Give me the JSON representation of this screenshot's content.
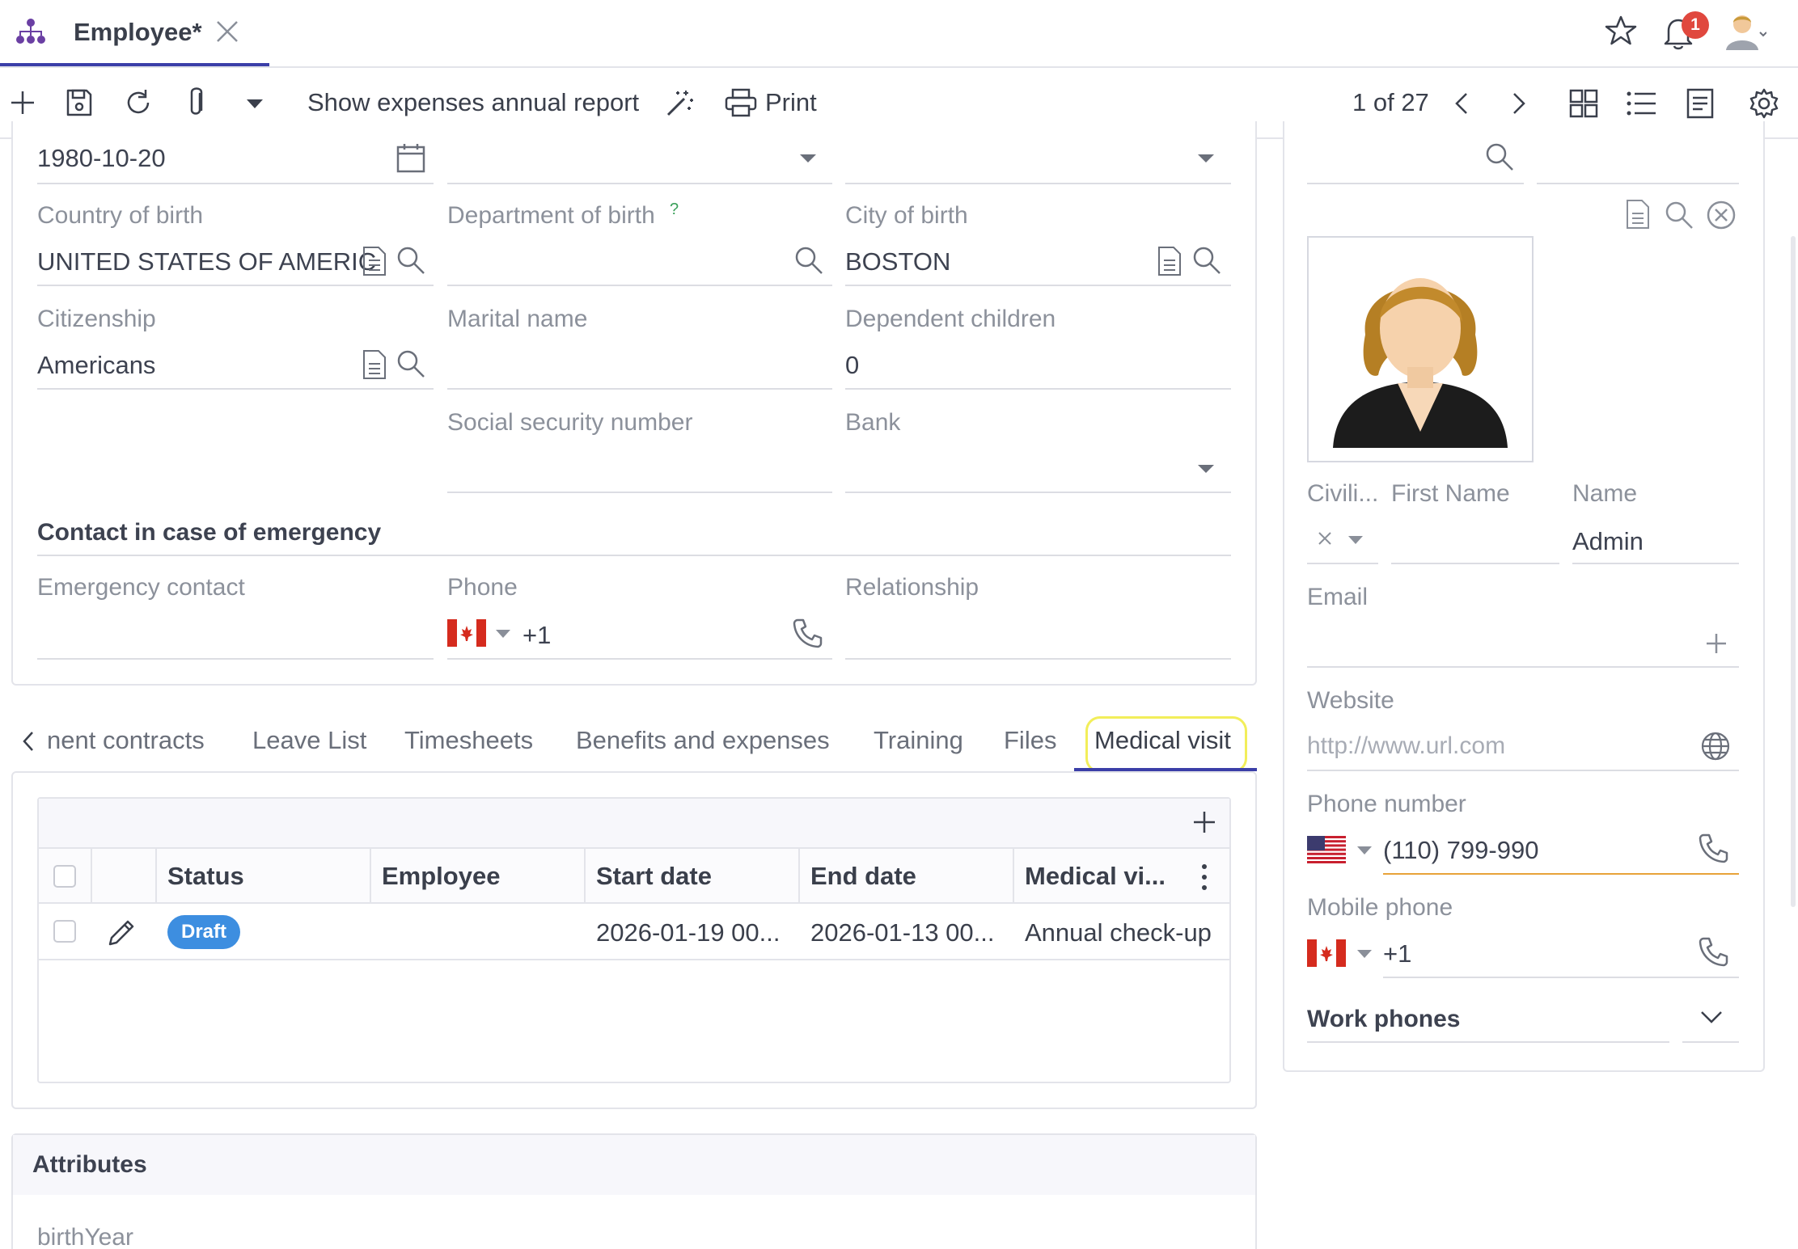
{
  "header": {
    "tab_title": "Employee*",
    "notification_count": "1"
  },
  "toolbar": {
    "report_label": "Show expenses annual report",
    "print_label": "Print",
    "pager": "1 of 27"
  },
  "form": {
    "birth_date": "1980-10-20",
    "country_of_birth_label": "Country of birth",
    "country_of_birth_value": "UNITED STATES OF AMERIC",
    "department_of_birth_label": "Department of birth",
    "department_help": "?",
    "city_of_birth_label": "City of birth",
    "city_of_birth_value": "BOSTON",
    "citizenship_label": "Citizenship",
    "citizenship_value": "Americans",
    "marital_name_label": "Marital name",
    "dependent_children_label": "Dependent children",
    "dependent_children_value": "0",
    "ssn_label": "Social security number",
    "bank_label": "Bank",
    "emergency_section_title": "Contact in case of emergency",
    "emergency_contact_label": "Emergency contact",
    "phone_label": "Phone",
    "phone_prefix": "+1",
    "relationship_label": "Relationship"
  },
  "tabs": {
    "items": [
      "nent contracts",
      "Leave List",
      "Timesheets",
      "Benefits and expenses",
      "Training",
      "Files",
      "Medical visit"
    ],
    "active": "Medical visit"
  },
  "grid": {
    "columns": [
      "Status",
      "Employee",
      "Start date",
      "End date",
      "Medical vi..."
    ],
    "rows": [
      {
        "status": "Draft",
        "employee": "",
        "start_date": "2026-01-19 00...",
        "end_date": "2026-01-13 00...",
        "medical_visit": "Annual check-up"
      }
    ]
  },
  "attributes": {
    "title": "Attributes",
    "field": "birthYear"
  },
  "side": {
    "civility_label": "Civili...",
    "first_name_label": "First Name",
    "name_label": "Name",
    "name_value": "Admin",
    "email_label": "Email",
    "website_label": "Website",
    "website_placeholder": "http://www.url.com",
    "phone_number_label": "Phone number",
    "phone_number_value": "(110) 799-990",
    "mobile_phone_label": "Mobile phone",
    "mobile_phone_value": "+1",
    "work_phones_label": "Work phones"
  },
  "colors": {
    "accent": "#3b3fa8",
    "highlight": "#f2ee5a",
    "badge_blue": "#3d8ee0",
    "notif_red": "#e0483e"
  }
}
